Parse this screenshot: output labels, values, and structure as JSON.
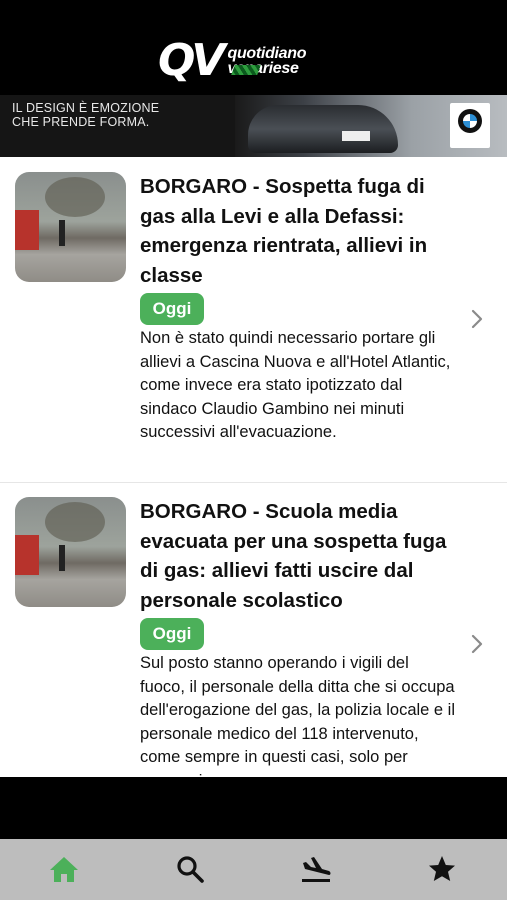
{
  "header": {
    "logo_letters": "QV",
    "logo_word1": "quotidiano",
    "logo_word2": "venariese"
  },
  "banner": {
    "tagline_line1": "IL DESIGN È EMOZIONE",
    "tagline_line2": "CHE PRENDE FORMA.",
    "brand_icon": "bmw-logo"
  },
  "articles": [
    {
      "title": "BORGARO - Sospetta fuga di gas alla Levi e alla Defassi: emergenza rientrata, allievi in classe",
      "badge": "Oggi",
      "excerpt": "Non è stato quindi necessario portare gli allievi a Cascina Nuova e all'Hotel Atlantic, come invece era stato ipotizzato dal sindaco Claudio Gambino nei minuti successivi all'evacuazione."
    },
    {
      "title": "BORGARO - Scuola media evacuata per una sospetta fuga di gas: allievi fatti uscire dal personale scolastico",
      "badge": "Oggi",
      "excerpt": "Sul posto stanno operando i vigili del fuoco, il personale della ditta che si occupa dell'erogazione del gas, la polizia locale e il personale medico del 118 intervenuto, come sempre in questi casi, solo per precauzione."
    }
  ],
  "colors": {
    "accent": "#4cb05a",
    "header_bg": "#000000",
    "tabbar_bg": "#bdbdbd"
  },
  "tabs": [
    {
      "icon": "home-icon",
      "active": true
    },
    {
      "icon": "search-icon",
      "active": false
    },
    {
      "icon": "plane-landing-icon",
      "active": false
    },
    {
      "icon": "star-icon",
      "active": false
    }
  ]
}
